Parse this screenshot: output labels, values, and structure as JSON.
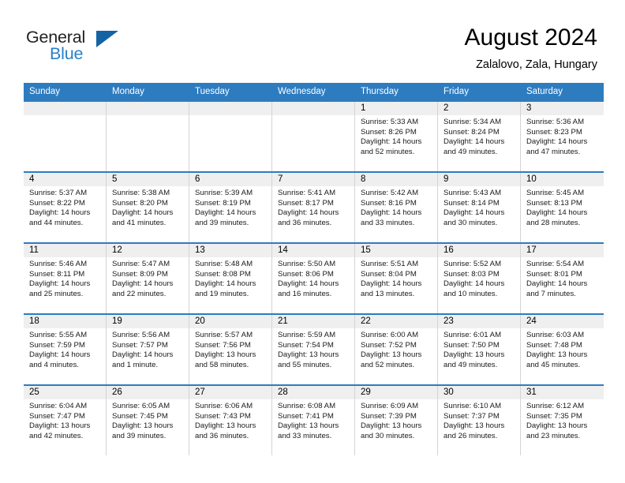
{
  "brand": {
    "name_top": "General",
    "name_bottom": "Blue",
    "accent_dark": "#231f20",
    "accent_blue": "#2a7fc9",
    "triangle_blue": "#1463a5"
  },
  "header": {
    "title": "August 2024",
    "subtitle": "Zalalovo, Zala, Hungary"
  },
  "theme": {
    "header_bar": "#2e7cc0",
    "daynum_band": "#efefef",
    "cell_border": "#d4d4d4"
  },
  "weekdays": [
    "Sunday",
    "Monday",
    "Tuesday",
    "Wednesday",
    "Thursday",
    "Friday",
    "Saturday"
  ],
  "weeks": [
    [
      {
        "num": "",
        "sunrise": "",
        "sunset": "",
        "daylight1": "",
        "daylight2": "",
        "empty": true
      },
      {
        "num": "",
        "sunrise": "",
        "sunset": "",
        "daylight1": "",
        "daylight2": "",
        "empty": true
      },
      {
        "num": "",
        "sunrise": "",
        "sunset": "",
        "daylight1": "",
        "daylight2": "",
        "empty": true
      },
      {
        "num": "",
        "sunrise": "",
        "sunset": "",
        "daylight1": "",
        "daylight2": "",
        "empty": true
      },
      {
        "num": "1",
        "sunrise": "Sunrise: 5:33 AM",
        "sunset": "Sunset: 8:26 PM",
        "daylight1": "Daylight: 14 hours",
        "daylight2": "and 52 minutes."
      },
      {
        "num": "2",
        "sunrise": "Sunrise: 5:34 AM",
        "sunset": "Sunset: 8:24 PM",
        "daylight1": "Daylight: 14 hours",
        "daylight2": "and 49 minutes."
      },
      {
        "num": "3",
        "sunrise": "Sunrise: 5:36 AM",
        "sunset": "Sunset: 8:23 PM",
        "daylight1": "Daylight: 14 hours",
        "daylight2": "and 47 minutes."
      }
    ],
    [
      {
        "num": "4",
        "sunrise": "Sunrise: 5:37 AM",
        "sunset": "Sunset: 8:22 PM",
        "daylight1": "Daylight: 14 hours",
        "daylight2": "and 44 minutes."
      },
      {
        "num": "5",
        "sunrise": "Sunrise: 5:38 AM",
        "sunset": "Sunset: 8:20 PM",
        "daylight1": "Daylight: 14 hours",
        "daylight2": "and 41 minutes."
      },
      {
        "num": "6",
        "sunrise": "Sunrise: 5:39 AM",
        "sunset": "Sunset: 8:19 PM",
        "daylight1": "Daylight: 14 hours",
        "daylight2": "and 39 minutes."
      },
      {
        "num": "7",
        "sunrise": "Sunrise: 5:41 AM",
        "sunset": "Sunset: 8:17 PM",
        "daylight1": "Daylight: 14 hours",
        "daylight2": "and 36 minutes."
      },
      {
        "num": "8",
        "sunrise": "Sunrise: 5:42 AM",
        "sunset": "Sunset: 8:16 PM",
        "daylight1": "Daylight: 14 hours",
        "daylight2": "and 33 minutes."
      },
      {
        "num": "9",
        "sunrise": "Sunrise: 5:43 AM",
        "sunset": "Sunset: 8:14 PM",
        "daylight1": "Daylight: 14 hours",
        "daylight2": "and 30 minutes."
      },
      {
        "num": "10",
        "sunrise": "Sunrise: 5:45 AM",
        "sunset": "Sunset: 8:13 PM",
        "daylight1": "Daylight: 14 hours",
        "daylight2": "and 28 minutes."
      }
    ],
    [
      {
        "num": "11",
        "sunrise": "Sunrise: 5:46 AM",
        "sunset": "Sunset: 8:11 PM",
        "daylight1": "Daylight: 14 hours",
        "daylight2": "and 25 minutes."
      },
      {
        "num": "12",
        "sunrise": "Sunrise: 5:47 AM",
        "sunset": "Sunset: 8:09 PM",
        "daylight1": "Daylight: 14 hours",
        "daylight2": "and 22 minutes."
      },
      {
        "num": "13",
        "sunrise": "Sunrise: 5:48 AM",
        "sunset": "Sunset: 8:08 PM",
        "daylight1": "Daylight: 14 hours",
        "daylight2": "and 19 minutes."
      },
      {
        "num": "14",
        "sunrise": "Sunrise: 5:50 AM",
        "sunset": "Sunset: 8:06 PM",
        "daylight1": "Daylight: 14 hours",
        "daylight2": "and 16 minutes."
      },
      {
        "num": "15",
        "sunrise": "Sunrise: 5:51 AM",
        "sunset": "Sunset: 8:04 PM",
        "daylight1": "Daylight: 14 hours",
        "daylight2": "and 13 minutes."
      },
      {
        "num": "16",
        "sunrise": "Sunrise: 5:52 AM",
        "sunset": "Sunset: 8:03 PM",
        "daylight1": "Daylight: 14 hours",
        "daylight2": "and 10 minutes."
      },
      {
        "num": "17",
        "sunrise": "Sunrise: 5:54 AM",
        "sunset": "Sunset: 8:01 PM",
        "daylight1": "Daylight: 14 hours",
        "daylight2": "and 7 minutes."
      }
    ],
    [
      {
        "num": "18",
        "sunrise": "Sunrise: 5:55 AM",
        "sunset": "Sunset: 7:59 PM",
        "daylight1": "Daylight: 14 hours",
        "daylight2": "and 4 minutes."
      },
      {
        "num": "19",
        "sunrise": "Sunrise: 5:56 AM",
        "sunset": "Sunset: 7:57 PM",
        "daylight1": "Daylight: 14 hours",
        "daylight2": "and 1 minute."
      },
      {
        "num": "20",
        "sunrise": "Sunrise: 5:57 AM",
        "sunset": "Sunset: 7:56 PM",
        "daylight1": "Daylight: 13 hours",
        "daylight2": "and 58 minutes."
      },
      {
        "num": "21",
        "sunrise": "Sunrise: 5:59 AM",
        "sunset": "Sunset: 7:54 PM",
        "daylight1": "Daylight: 13 hours",
        "daylight2": "and 55 minutes."
      },
      {
        "num": "22",
        "sunrise": "Sunrise: 6:00 AM",
        "sunset": "Sunset: 7:52 PM",
        "daylight1": "Daylight: 13 hours",
        "daylight2": "and 52 minutes."
      },
      {
        "num": "23",
        "sunrise": "Sunrise: 6:01 AM",
        "sunset": "Sunset: 7:50 PM",
        "daylight1": "Daylight: 13 hours",
        "daylight2": "and 49 minutes."
      },
      {
        "num": "24",
        "sunrise": "Sunrise: 6:03 AM",
        "sunset": "Sunset: 7:48 PM",
        "daylight1": "Daylight: 13 hours",
        "daylight2": "and 45 minutes."
      }
    ],
    [
      {
        "num": "25",
        "sunrise": "Sunrise: 6:04 AM",
        "sunset": "Sunset: 7:47 PM",
        "daylight1": "Daylight: 13 hours",
        "daylight2": "and 42 minutes."
      },
      {
        "num": "26",
        "sunrise": "Sunrise: 6:05 AM",
        "sunset": "Sunset: 7:45 PM",
        "daylight1": "Daylight: 13 hours",
        "daylight2": "and 39 minutes."
      },
      {
        "num": "27",
        "sunrise": "Sunrise: 6:06 AM",
        "sunset": "Sunset: 7:43 PM",
        "daylight1": "Daylight: 13 hours",
        "daylight2": "and 36 minutes."
      },
      {
        "num": "28",
        "sunrise": "Sunrise: 6:08 AM",
        "sunset": "Sunset: 7:41 PM",
        "daylight1": "Daylight: 13 hours",
        "daylight2": "and 33 minutes."
      },
      {
        "num": "29",
        "sunrise": "Sunrise: 6:09 AM",
        "sunset": "Sunset: 7:39 PM",
        "daylight1": "Daylight: 13 hours",
        "daylight2": "and 30 minutes."
      },
      {
        "num": "30",
        "sunrise": "Sunrise: 6:10 AM",
        "sunset": "Sunset: 7:37 PM",
        "daylight1": "Daylight: 13 hours",
        "daylight2": "and 26 minutes."
      },
      {
        "num": "31",
        "sunrise": "Sunrise: 6:12 AM",
        "sunset": "Sunset: 7:35 PM",
        "daylight1": "Daylight: 13 hours",
        "daylight2": "and 23 minutes."
      }
    ]
  ]
}
